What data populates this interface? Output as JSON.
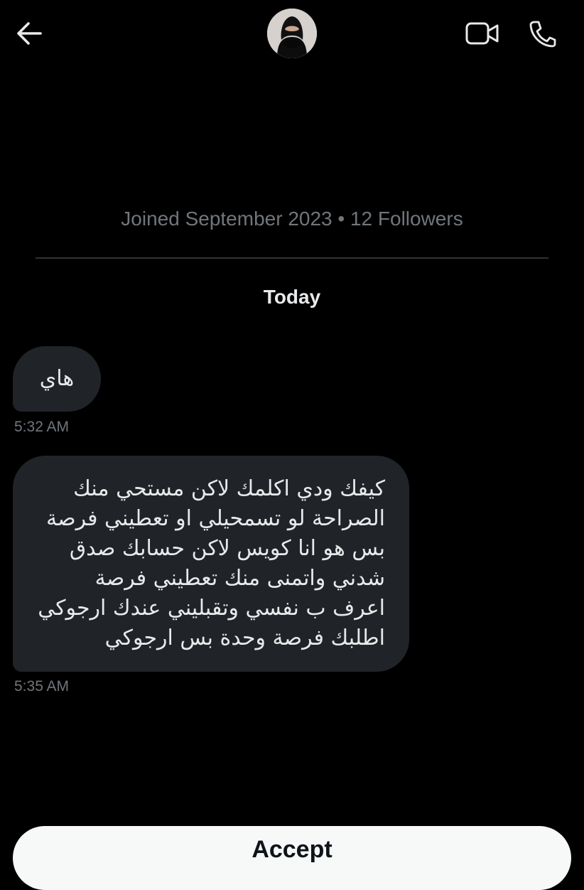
{
  "header": {
    "back_icon": "arrow-left-icon",
    "video_icon": "video-camera-icon",
    "call_icon": "phone-icon",
    "avatar_icon": "avatar-image"
  },
  "profile": {
    "meta": "Joined September 2023 • 12 Followers"
  },
  "conversation": {
    "day_label": "Today",
    "messages": [
      {
        "lines": [
          "هاي"
        ],
        "time": "5:32 AM"
      },
      {
        "lines": [
          "كيفك ودي اكلمك لاكن مستحي منك",
          "الصراحة لو تسمحيلي او تعطيني فرصة",
          "بس هو انا كويس لاكن حسابك صدق",
          "شدني واتمنى منك تعطيني فرصة",
          "اعرف ب نفسي وتقبليني عندك ارجوكي",
          "اطلبك فرصة وحدة بس ارجوكي"
        ],
        "time": "5:35 AM"
      }
    ]
  },
  "footer": {
    "button_label": "Accept"
  },
  "colors": {
    "background": "#000000",
    "bubble": "#202327",
    "muted_text": "#71767b",
    "primary_text": "#e7e9ea",
    "divider": "#2f3336",
    "button_bg": "#f7f9f9"
  }
}
